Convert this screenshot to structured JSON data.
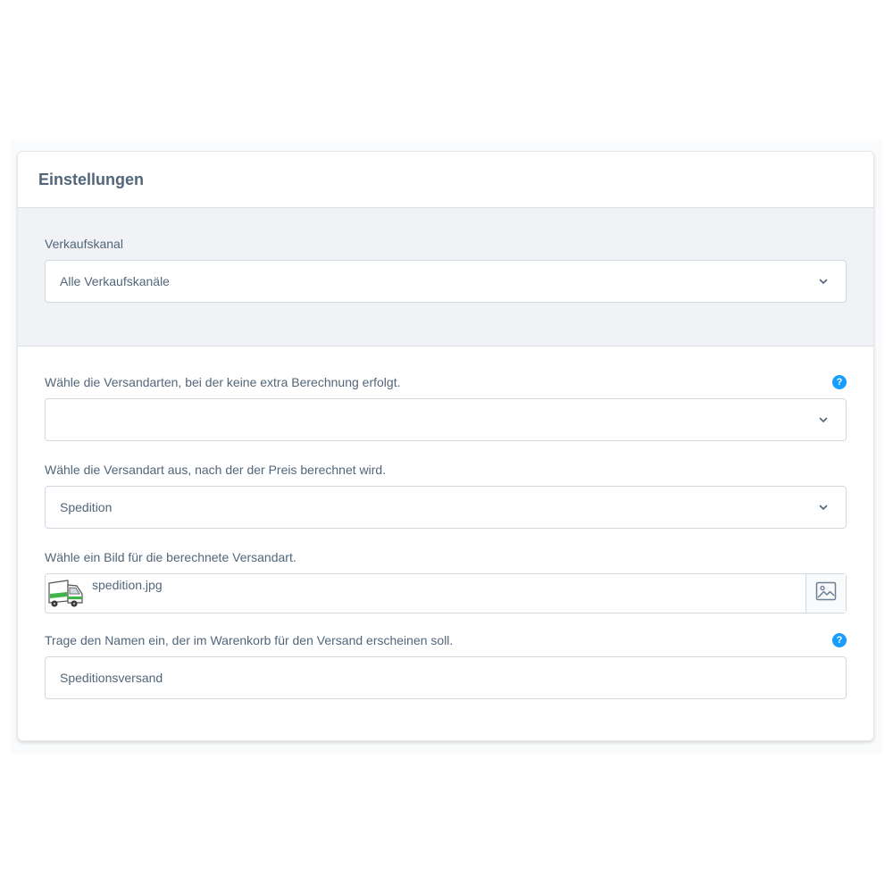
{
  "card": {
    "title": "Einstellungen"
  },
  "sales_channel": {
    "label": "Verkaufskanal",
    "value": "Alle Verkaufskanäle"
  },
  "fields": {
    "excluded_shipping": {
      "label": "Wähle die Versandarten, bei der keine extra Berechnung erfolgt.",
      "value": "",
      "help_icon": "question-mark"
    },
    "calc_shipping": {
      "label": "Wähle die Versandart aus, nach der der Preis berechnet wird.",
      "value": "Spedition"
    },
    "image": {
      "label": "Wähle ein Bild für die berechnete Versandart.",
      "file_name": "spedition.jpg",
      "thumb_icon": "truck",
      "button_icon": "image"
    },
    "cart_name": {
      "label": "Trage den Namen ein, der im Warenkorb für den Versand erscheinen soll.",
      "value": "Speditionsversand",
      "help_icon": "question-mark"
    }
  },
  "colors": {
    "accent": "#189eff",
    "text": "#52667a",
    "border": "#d1d9e0",
    "grey_section": "#f0f2f5",
    "truck_green": "#3fb44a"
  }
}
